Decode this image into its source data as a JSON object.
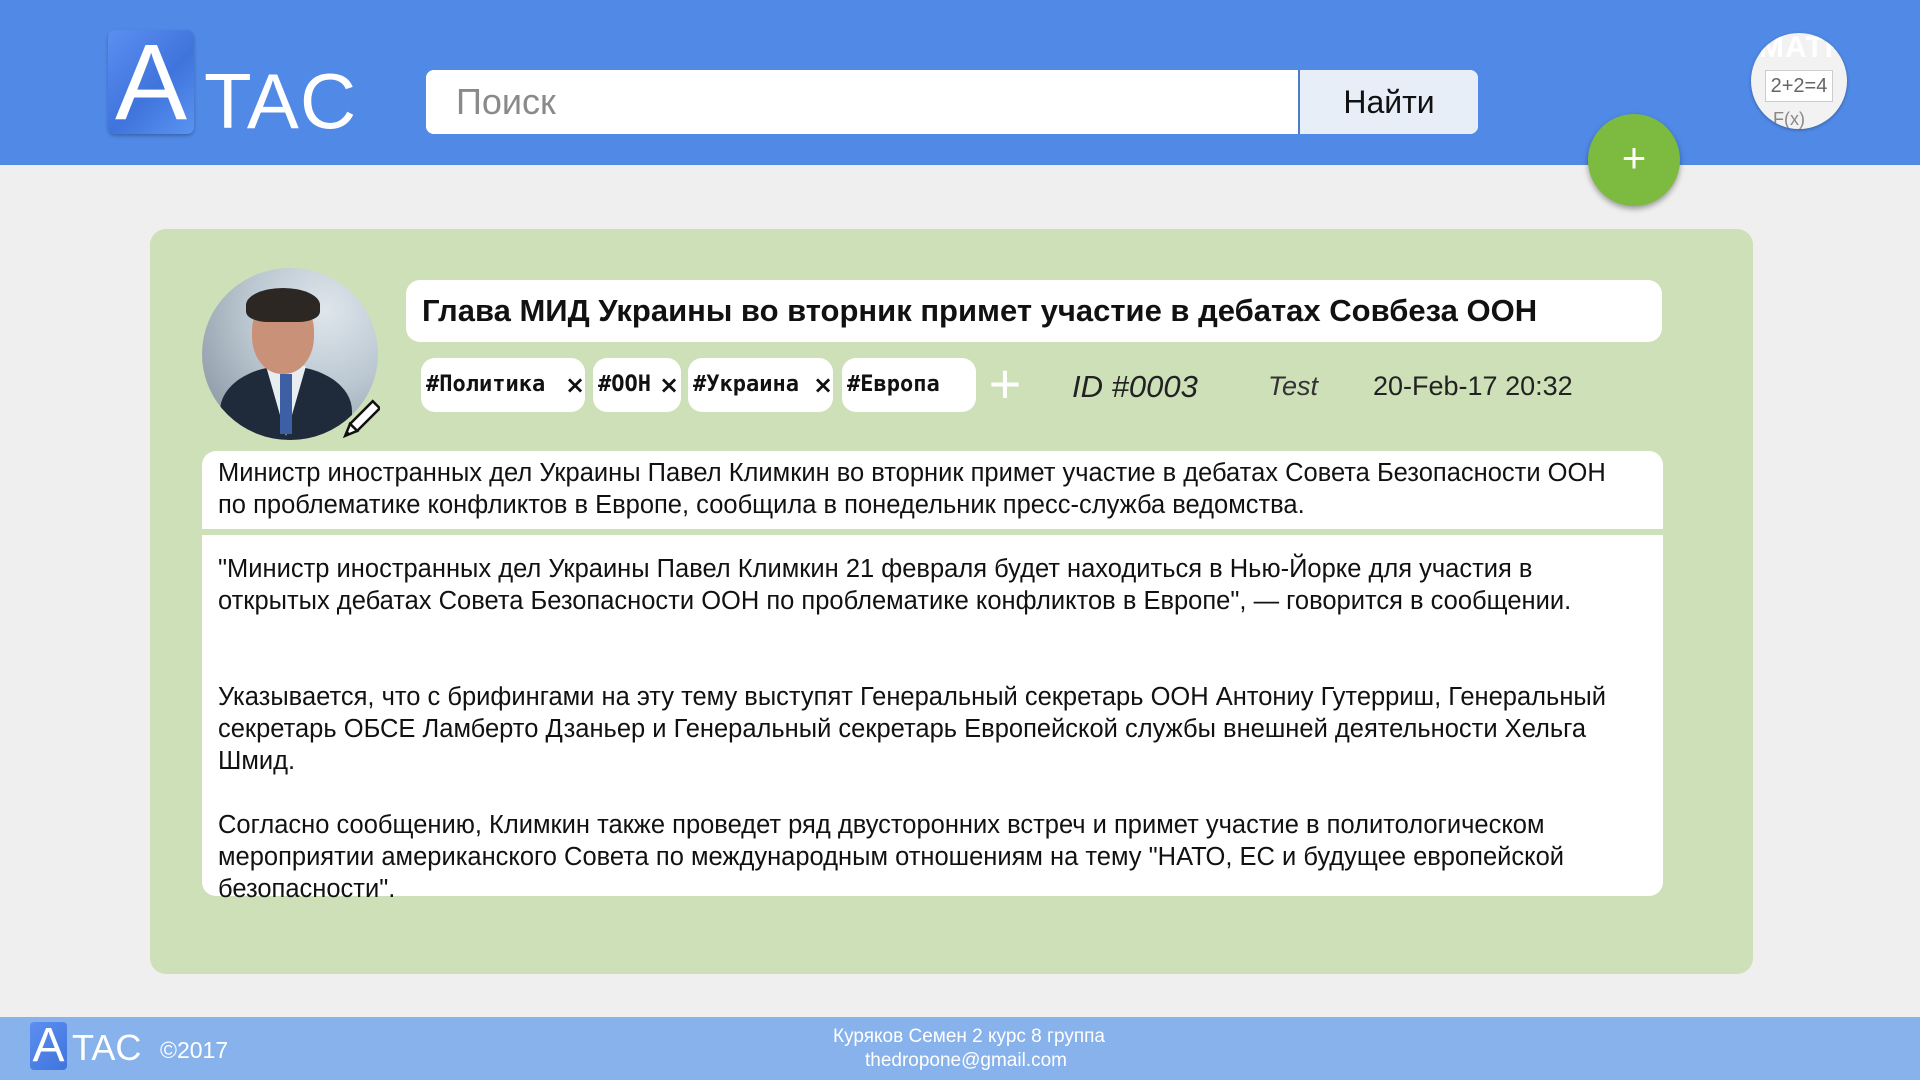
{
  "header": {
    "logo_letter": "A",
    "logo_text": "TAC",
    "search_placeholder": "Поиск",
    "search_button": "Найти",
    "math_widget": {
      "title": "MATH",
      "equation": "2+2=4",
      "func": "F(x)"
    },
    "add_button": "+"
  },
  "article": {
    "title": "Глава МИД Украины во вторник примет участие в дебатах Совбеза ООН",
    "tags": [
      {
        "label": "#Политика",
        "remove": "×"
      },
      {
        "label": "#ООН",
        "remove": "×"
      },
      {
        "label": "#Украина",
        "remove": "×"
      },
      {
        "label": "#Европа"
      }
    ],
    "add_tag": "+",
    "id": "ID #0003",
    "user": "Test",
    "date": "20-Feb-17 20:32",
    "lead": "Министр иностранных дел Украины Павел Климкин во вторник примет участие в дебатах Совета Безопасности ООН по проблематике конфликтов в Европе, сообщила в понедельник пресс-служба ведомства.",
    "paragraphs": [
      "\"Министр иностранных дел Украины Павел Климкин 21 февраля будет находиться в Нью-Йорке для участия в открытых дебатах Совета Безопасности ООН по проблематике конфликтов в Европе\", — говорится в сообщении.",
      "Указывается, что с брифингами на эту тему выступят Генеральный секретарь ООН Антониу Гутерриш, Генеральный секретарь ОБСЕ Ламберто Дзаньер и Генеральный секретарь Европейской службы внешней деятельности Хельга Шмид.",
      "Согласно сообщению, Климкин также проведет ряд двусторонних встреч и примет участие в политологическом мероприятии американского Совета по международным отношениям на тему \"НАТО, ЕС и будущее европейской безопасности\"."
    ]
  },
  "footer": {
    "logo_letter": "A",
    "logo_text": "TAC",
    "copyright": "©2017",
    "author": "Куряков Семен 2 курс 8 группа",
    "email": "thedropone@gmail.com"
  },
  "colors": {
    "header_bg": "#5089e6",
    "card_bg": "#cde0b8",
    "fab_bg": "#7cbb3f",
    "footer_bg": "#88b2ec"
  }
}
